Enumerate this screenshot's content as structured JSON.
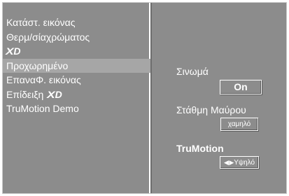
{
  "menu": {
    "items": [
      {
        "label": "Κατάστ. εικόνας",
        "type": "text"
      },
      {
        "label": "Θερμ/σίαχρώματος",
        "type": "text"
      },
      {
        "label": "XD",
        "type": "logo"
      },
      {
        "label": "Προχωρημένο",
        "type": "text",
        "selected": true
      },
      {
        "label": "ΕπαναΦ. εικόνας",
        "type": "text"
      },
      {
        "label": "Επίδειξη",
        "type": "text+logo",
        "logo": "XD"
      },
      {
        "label": "TruMotion Demo",
        "type": "text"
      }
    ]
  },
  "settings": {
    "cinema": {
      "label": "Σινωμά",
      "value": "On"
    },
    "black_level": {
      "label": "Στάθμη Μαύρου",
      "value": "χαμηλό"
    },
    "trumotion": {
      "label": "TruMotion",
      "value": "Υψηλό",
      "arrows": "◀ ▶"
    }
  },
  "colors": {
    "panel_bg": "#8c8c8c",
    "selected_bg": "#a6a6a6",
    "text": "#ffffff"
  }
}
